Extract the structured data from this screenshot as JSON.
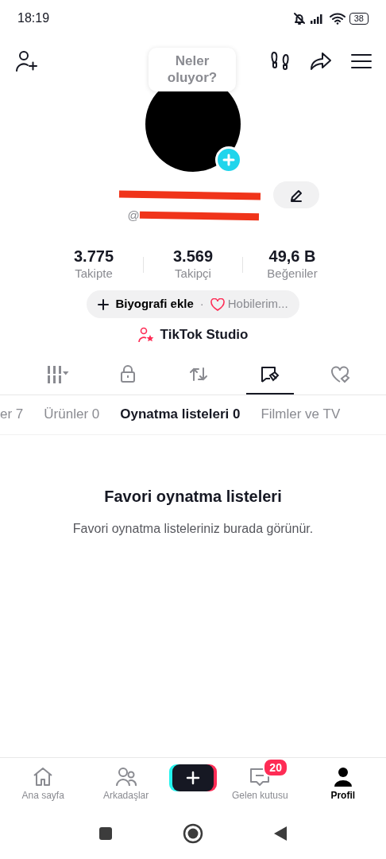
{
  "status_bar": {
    "time": "18:19",
    "battery": "38"
  },
  "header": {
    "tooltip": "Neler oluyor?"
  },
  "profile": {
    "handle_prefix": "@",
    "name_redacted": true
  },
  "stats": [
    {
      "value": "3.775",
      "label": "Takipte"
    },
    {
      "value": "3.569",
      "label": "Takipçi"
    },
    {
      "value": "49,6 B",
      "label": "Beğeniler"
    }
  ],
  "bio_chip": {
    "action": "Biyografi ekle",
    "separator": "·",
    "hobbies": "Hobilerim..."
  },
  "studio_link": "TikTok Studio",
  "content_tabs": [
    {
      "kind": "grid",
      "selected": false
    },
    {
      "kind": "lock",
      "selected": false
    },
    {
      "kind": "repost",
      "selected": false
    },
    {
      "kind": "playlist",
      "selected": true
    },
    {
      "kind": "liked",
      "selected": false
    }
  ],
  "sub_tabs": [
    {
      "label": "er 7",
      "selected": false
    },
    {
      "label": "Ürünler 0",
      "selected": false
    },
    {
      "label": "Oynatma listeleri 0",
      "selected": true
    },
    {
      "label": "Filmler ve TV",
      "selected": false
    }
  ],
  "empty_state": {
    "title": "Favori oynatma listeleri",
    "message": "Favori oynatma listeleriniz burada görünür."
  },
  "bottom_nav": [
    {
      "kind": "home",
      "label": "Ana sayfa",
      "selected": false
    },
    {
      "kind": "friends",
      "label": "Arkadaşlar",
      "selected": false
    },
    {
      "kind": "create"
    },
    {
      "kind": "inbox",
      "label": "Gelen kutusu",
      "badge": "20",
      "selected": false
    },
    {
      "kind": "profile",
      "label": "Profil",
      "selected": true
    }
  ]
}
